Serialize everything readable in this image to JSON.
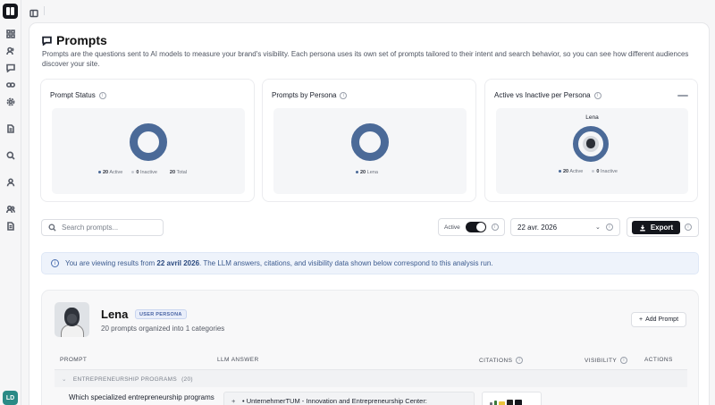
{
  "sidebar": {
    "avatar_initials": "LD"
  },
  "page": {
    "title": "Prompts",
    "description": "Prompts are the questions sent to AI models to measure your brand's visibility. Each persona uses its own set of prompts tailored to their intent and search behavior, so you can see how different audiences discover your site."
  },
  "cards": {
    "status": {
      "title": "Prompt Status",
      "active_count": "20",
      "active_label": "Active",
      "inactive_count": "0",
      "inactive_label": "Inactive",
      "total_count": "20",
      "total_label": "Total"
    },
    "persona": {
      "title": "Prompts by Persona",
      "count": "20",
      "label": "Lena"
    },
    "active_inactive": {
      "title": "Active vs Inactive per Persona",
      "persona_name": "Lena",
      "active_count": "20",
      "active_label": "Active",
      "inactive_count": "0",
      "inactive_label": "Inactive"
    }
  },
  "chart_data": [
    {
      "type": "pie",
      "categories": [
        "Active",
        "Inactive"
      ],
      "values": [
        20,
        0
      ]
    },
    {
      "type": "pie",
      "categories": [
        "Lena"
      ],
      "values": [
        20
      ]
    },
    {
      "type": "pie",
      "title": "Lena",
      "categories": [
        "Active",
        "Inactive"
      ],
      "values": [
        20,
        0
      ]
    }
  ],
  "toolbar": {
    "search_placeholder": "Search prompts...",
    "active_label": "Active",
    "active_toggle_on": true,
    "date_value": "22 avr. 2026",
    "export_label": "Export"
  },
  "banner": {
    "prefix": "You are viewing results from ",
    "date": "22 avril 2026",
    "suffix": ". The LLM answers, citations, and visibility data shown below correspond to this analysis run."
  },
  "persona": {
    "name": "Lena",
    "badge": "USER PERSONA",
    "subtitle": "20 prompts organized into 1 categories",
    "add_prompt_label": "Add Prompt"
  },
  "table": {
    "headers": {
      "prompt": "PROMPT",
      "llm_answer": "LLM ANSWER",
      "citations": "CITATIONS",
      "visibility": "VISIBILITY",
      "actions": "ACTIONS"
    },
    "category": {
      "name": "ENTREPRENEURSHIP PROGRAMS",
      "count": "(20)"
    },
    "rows": [
      {
        "prompt": "Which specialized entrepreneurship programs",
        "answer": "• UnternehmerTUM - Innovation and Entrepreneurship Center:"
      }
    ]
  },
  "colors": {
    "donut": "#4b6a98",
    "accent_dark": "#14161c",
    "banner_bg": "#eef3fb"
  }
}
